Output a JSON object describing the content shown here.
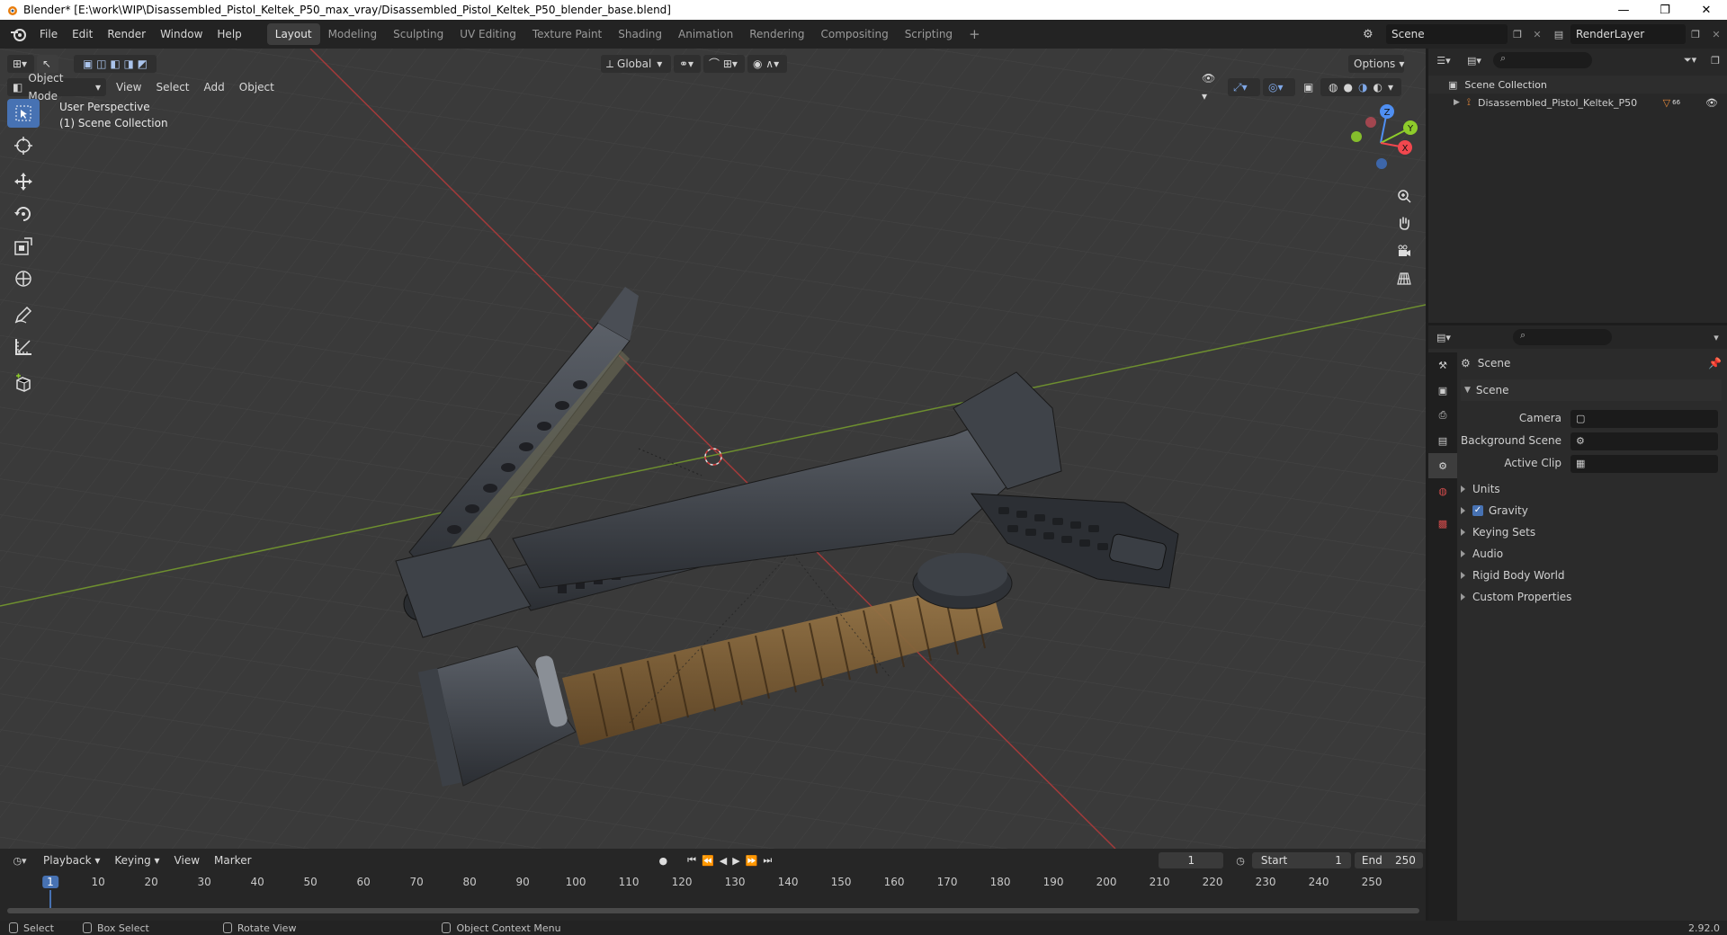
{
  "window": {
    "title": "Blender* [E:\\work\\WIP\\Disassembled_Pistol_Keltek_P50_max_vray/Disassembled_Pistol_Keltek_P50_blender_base.blend]",
    "minimize": "—",
    "maximize": "❐",
    "close": "✕"
  },
  "menu": [
    "File",
    "Edit",
    "Render",
    "Window",
    "Help"
  ],
  "workspaces": [
    "Layout",
    "Modeling",
    "Sculpting",
    "UV Editing",
    "Texture Paint",
    "Shading",
    "Animation",
    "Rendering",
    "Compositing",
    "Scripting"
  ],
  "workspace_add": "+",
  "scene_name": "Scene",
  "render_layer": "RenderLayer",
  "viewport": {
    "mode": "Object Mode",
    "menus": [
      "View",
      "Select",
      "Add",
      "Object"
    ],
    "transform_orientation": "Global",
    "options_label": "Options",
    "perspective_label": "User Perspective",
    "collection_label": "(1) Scene Collection",
    "gizmo_axes": {
      "x": "X",
      "y": "Y",
      "z": "Z"
    }
  },
  "outliner": {
    "root": "Scene Collection",
    "item": "Disassembled_Pistol_Keltek_P50",
    "item_badge": "66"
  },
  "properties": {
    "context_title": "Scene",
    "panel_title": "Scene",
    "fields": [
      {
        "label": "Camera",
        "value": ""
      },
      {
        "label": "Background Scene",
        "value": ""
      },
      {
        "label": "Active Clip",
        "value": ""
      }
    ],
    "subpanels": [
      "Units",
      "Gravity",
      "Keying Sets",
      "Audio",
      "Rigid Body World",
      "Custom Properties"
    ],
    "gravity_checked": true
  },
  "timeline": {
    "menus": [
      "Playback",
      "Keying",
      "View",
      "Marker"
    ],
    "current_frame": "1",
    "start_label": "Start",
    "start_value": "1",
    "end_label": "End",
    "end_value": "250",
    "ticks": [
      "1",
      "10",
      "20",
      "30",
      "40",
      "50",
      "60",
      "70",
      "80",
      "90",
      "100",
      "110",
      "120",
      "130",
      "140",
      "150",
      "160",
      "170",
      "180",
      "190",
      "200",
      "210",
      "220",
      "230",
      "240",
      "250"
    ]
  },
  "statusbar": {
    "select": "Select",
    "box_select": "Box Select",
    "rotate_view": "Rotate View",
    "context_menu": "Object Context Menu",
    "version": "2.92.0"
  },
  "colors": {
    "accent": "#4772b3",
    "x_axis": "#a33a3a",
    "y_axis": "#6e8f2f",
    "gizmo_x": "#f2474e",
    "gizmo_y": "#8ecc2b",
    "gizmo_z": "#4f8ff2"
  }
}
